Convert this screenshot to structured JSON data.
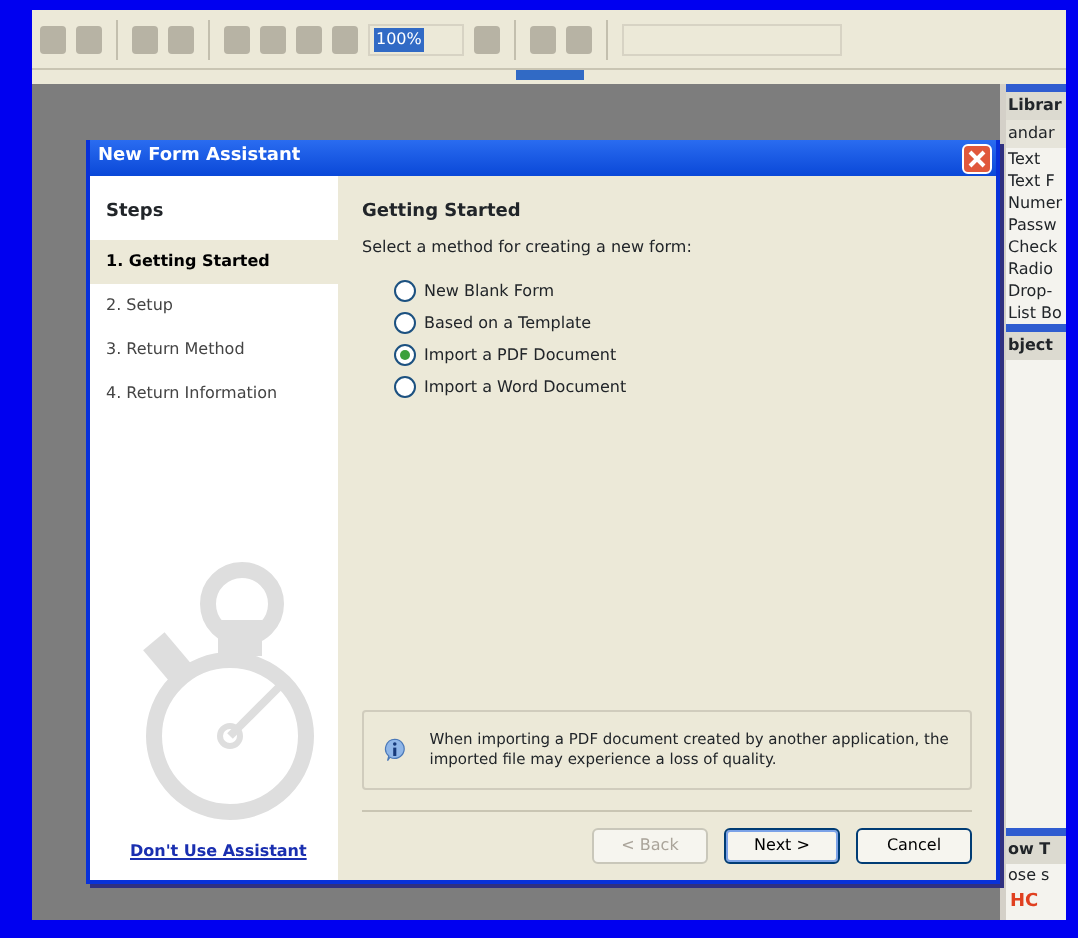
{
  "toolbar": {
    "zoom": "100%"
  },
  "right_panel": {
    "items": [
      {
        "kind": "header",
        "label": "Librar"
      },
      {
        "kind": "tab",
        "label": "andar"
      },
      {
        "kind": "item",
        "label": "Text"
      },
      {
        "kind": "item",
        "label": "Text F"
      },
      {
        "kind": "item",
        "label": "Numer"
      },
      {
        "kind": "item",
        "label": "Passw"
      },
      {
        "kind": "item",
        "label": "Check"
      },
      {
        "kind": "item",
        "label": "Radio"
      },
      {
        "kind": "item",
        "label": "Drop-"
      },
      {
        "kind": "item",
        "label": "List Bo"
      },
      {
        "kind": "header",
        "label": "bject"
      },
      {
        "kind": "spacer"
      },
      {
        "kind": "header",
        "label": "ow T"
      },
      {
        "kind": "item",
        "label": "ose s"
      },
      {
        "kind": "link",
        "label": "HC"
      }
    ]
  },
  "dialog": {
    "title": "New Form Assistant",
    "steps_heading": "Steps",
    "steps": [
      {
        "label": "1. Getting Started",
        "selected": true
      },
      {
        "label": "2. Setup",
        "selected": false
      },
      {
        "label": "3. Return Method",
        "selected": false
      },
      {
        "label": "4. Return Information",
        "selected": false
      }
    ],
    "link": "Don't Use Assistant",
    "heading": "Getting Started",
    "instruction": "Select a method for creating a new form:",
    "options": [
      {
        "label": "New Blank Form",
        "selected": false
      },
      {
        "label": "Based on a Template",
        "selected": false
      },
      {
        "label": "Import a PDF Document",
        "selected": true
      },
      {
        "label": "Import a Word Document",
        "selected": false
      }
    ],
    "info": "When importing a PDF document created by another application, the imported file may experience a loss of quality.",
    "buttons": [
      {
        "label": "< Back",
        "disabled": true,
        "default": false
      },
      {
        "label": "Next >",
        "disabled": false,
        "default": true
      },
      {
        "label": "Cancel",
        "disabled": false,
        "default": false
      }
    ]
  }
}
